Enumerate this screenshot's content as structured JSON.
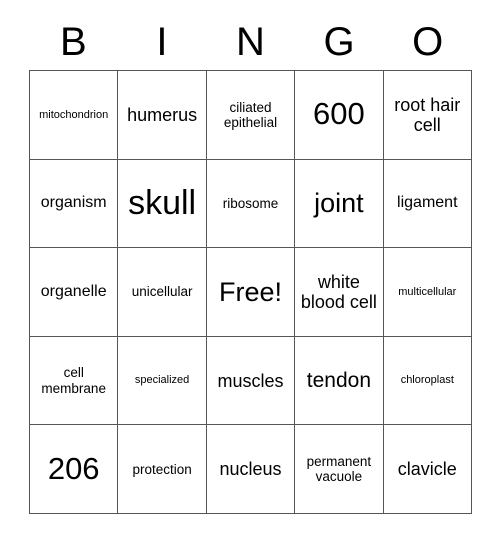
{
  "card": {
    "title": "BINGO",
    "header_letters": [
      "B",
      "I",
      "N",
      "G",
      "O"
    ],
    "free_space_label": "Free!",
    "colors": {
      "text": "#000000",
      "border": "#555555",
      "background": "#ffffff"
    },
    "rows": [
      [
        {
          "text": "mitochondrion",
          "size": "xs"
        },
        {
          "text": "humerus",
          "size": "ml"
        },
        {
          "text": "ciliated epithelial",
          "size": "s"
        },
        {
          "text": "600",
          "size": "xxl"
        },
        {
          "text": "root hair cell",
          "size": "ml"
        }
      ],
      [
        {
          "text": "organism",
          "size": "m"
        },
        {
          "text": "skull",
          "size": "huge"
        },
        {
          "text": "ribosome",
          "size": "s"
        },
        {
          "text": "joint",
          "size": "xl"
        },
        {
          "text": "ligament",
          "size": "m"
        }
      ],
      [
        {
          "text": "organelle",
          "size": "m"
        },
        {
          "text": "unicellular",
          "size": "s"
        },
        {
          "text": "Free!",
          "size": "xl"
        },
        {
          "text": "white blood cell",
          "size": "ml"
        },
        {
          "text": "multicellular",
          "size": "xs"
        }
      ],
      [
        {
          "text": "cell membrane",
          "size": "s"
        },
        {
          "text": "specialized",
          "size": "xs"
        },
        {
          "text": "muscles",
          "size": "ml"
        },
        {
          "text": "tendon",
          "size": "l"
        },
        {
          "text": "chloroplast",
          "size": "xs"
        }
      ],
      [
        {
          "text": "206",
          "size": "xxl"
        },
        {
          "text": "protection",
          "size": "s"
        },
        {
          "text": "nucleus",
          "size": "ml"
        },
        {
          "text": "permanent vacuole",
          "size": "s"
        },
        {
          "text": "clavicle",
          "size": "ml"
        }
      ]
    ]
  }
}
